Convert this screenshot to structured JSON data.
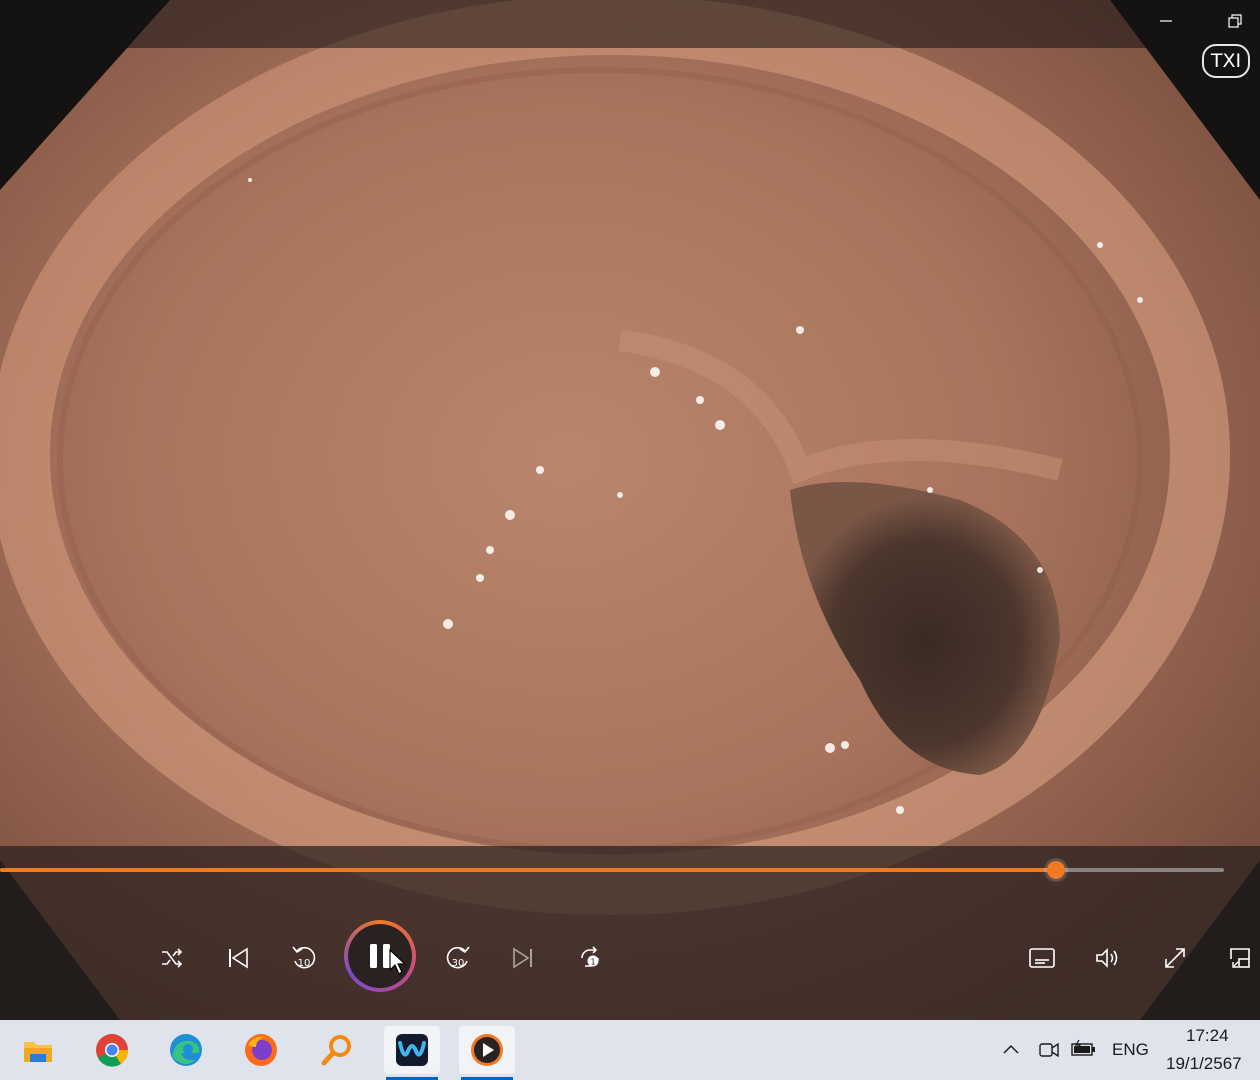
{
  "window": {
    "minimize_icon": "minimize-icon",
    "restore_icon": "restore-icon",
    "overlay_badge": "TXI"
  },
  "player": {
    "progress_fraction": 0.863,
    "state": "playing",
    "skip_back_label": "10",
    "skip_forward_label": "30",
    "repeat_label": "1",
    "accent_color": "#f07a22"
  },
  "taskbar": {
    "apps": [
      "file-explorer",
      "chrome",
      "edge",
      "firefox",
      "search-tool",
      "video-editor",
      "media-player"
    ],
    "language": "ENG",
    "time": "17:24",
    "date": "19/1/2567"
  }
}
